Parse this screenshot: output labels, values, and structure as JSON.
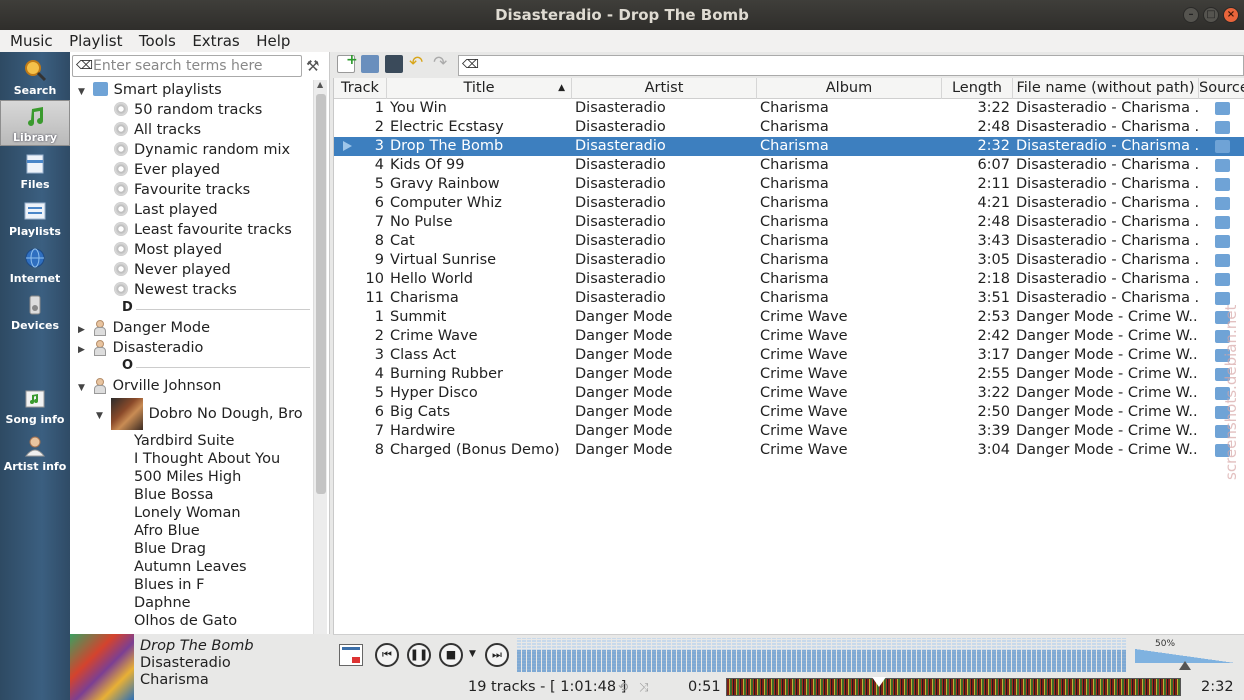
{
  "window": {
    "title": "Disasteradio - Drop The Bomb"
  },
  "menu": [
    "Music",
    "Playlist",
    "Tools",
    "Extras",
    "Help"
  ],
  "tabs": [
    {
      "label": "Search",
      "icon": "magnifier-icon"
    },
    {
      "label": "Library",
      "icon": "music-note-icon"
    },
    {
      "label": "Files",
      "icon": "files-icon"
    },
    {
      "label": "Playlists",
      "icon": "playlists-icon"
    },
    {
      "label": "Internet",
      "icon": "globe-icon"
    },
    {
      "label": "Devices",
      "icon": "devices-icon"
    },
    {
      "label": "Song info",
      "icon": "song-info-icon"
    },
    {
      "label": "Artist info",
      "icon": "artist-info-icon"
    }
  ],
  "library": {
    "search_placeholder": "Enter search terms here",
    "smart_playlists_label": "Smart playlists",
    "smart_playlists": [
      "50 random tracks",
      "All tracks",
      "Dynamic random mix",
      "Ever played",
      "Favourite tracks",
      "Last played",
      "Least favourite tracks",
      "Most played",
      "Never played",
      "Newest tracks"
    ],
    "divider_d": "D",
    "artists_d": [
      "Danger Mode",
      "Disasteradio"
    ],
    "divider_o": "O",
    "artist_o": "Orville Johnson",
    "album": "Dobro No Dough, Bro",
    "album_tracks": [
      "Yardbird Suite",
      "I Thought About You",
      "500 Miles High",
      "Blue Bossa",
      "Lonely Woman",
      "Afro Blue",
      "Blue Drag",
      "Autumn Leaves",
      "Blues in F",
      "Daphne",
      "Olhos de Gato"
    ]
  },
  "now_playing": {
    "title": "Drop The Bomb",
    "artist": "Disasteradio",
    "album": "Charisma"
  },
  "playlist": {
    "columns": [
      "Track",
      "Title",
      "Artist",
      "Album",
      "Length",
      "File name (without path)",
      "Source"
    ],
    "current_index": 2,
    "rows": [
      {
        "track": "1",
        "title": "You Win",
        "artist": "Disasteradio",
        "album": "Charisma",
        "length": "3:22",
        "file": "Disasteradio - Charisma ..."
      },
      {
        "track": "2",
        "title": "Electric Ecstasy",
        "artist": "Disasteradio",
        "album": "Charisma",
        "length": "2:48",
        "file": "Disasteradio - Charisma ..."
      },
      {
        "track": "3",
        "title": "Drop The Bomb",
        "artist": "Disasteradio",
        "album": "Charisma",
        "length": "2:32",
        "file": "Disasteradio - Charisma ..."
      },
      {
        "track": "4",
        "title": "Kids Of 99",
        "artist": "Disasteradio",
        "album": "Charisma",
        "length": "6:07",
        "file": "Disasteradio - Charisma ..."
      },
      {
        "track": "5",
        "title": "Gravy Rainbow",
        "artist": "Disasteradio",
        "album": "Charisma",
        "length": "2:11",
        "file": "Disasteradio - Charisma ..."
      },
      {
        "track": "6",
        "title": "Computer Whiz",
        "artist": "Disasteradio",
        "album": "Charisma",
        "length": "4:21",
        "file": "Disasteradio - Charisma ..."
      },
      {
        "track": "7",
        "title": "No Pulse",
        "artist": "Disasteradio",
        "album": "Charisma",
        "length": "2:48",
        "file": "Disasteradio - Charisma ..."
      },
      {
        "track": "8",
        "title": "Cat",
        "artist": "Disasteradio",
        "album": "Charisma",
        "length": "3:43",
        "file": "Disasteradio - Charisma ..."
      },
      {
        "track": "9",
        "title": "Virtual Sunrise",
        "artist": "Disasteradio",
        "album": "Charisma",
        "length": "3:05",
        "file": "Disasteradio - Charisma ..."
      },
      {
        "track": "10",
        "title": "Hello World",
        "artist": "Disasteradio",
        "album": "Charisma",
        "length": "2:18",
        "file": "Disasteradio - Charisma ..."
      },
      {
        "track": "11",
        "title": "Charisma",
        "artist": "Disasteradio",
        "album": "Charisma",
        "length": "3:51",
        "file": "Disasteradio - Charisma ..."
      },
      {
        "track": "1",
        "title": "Summit",
        "artist": "Danger Mode",
        "album": "Crime Wave",
        "length": "2:53",
        "file": "Danger Mode - Crime W..."
      },
      {
        "track": "2",
        "title": "Crime Wave",
        "artist": "Danger Mode",
        "album": "Crime Wave",
        "length": "2:42",
        "file": "Danger Mode - Crime W..."
      },
      {
        "track": "3",
        "title": "Class Act",
        "artist": "Danger Mode",
        "album": "Crime Wave",
        "length": "3:17",
        "file": "Danger Mode - Crime W..."
      },
      {
        "track": "4",
        "title": "Burning Rubber",
        "artist": "Danger Mode",
        "album": "Crime Wave",
        "length": "2:55",
        "file": "Danger Mode - Crime W..."
      },
      {
        "track": "5",
        "title": "Hyper Disco",
        "artist": "Danger Mode",
        "album": "Crime Wave",
        "length": "3:22",
        "file": "Danger Mode - Crime W..."
      },
      {
        "track": "6",
        "title": "Big Cats",
        "artist": "Danger Mode",
        "album": "Crime Wave",
        "length": "2:50",
        "file": "Danger Mode - Crime W..."
      },
      {
        "track": "7",
        "title": "Hardwire",
        "artist": "Danger Mode",
        "album": "Crime Wave",
        "length": "3:39",
        "file": "Danger Mode - Crime W..."
      },
      {
        "track": "8",
        "title": "Charged (Bonus Demo)",
        "artist": "Danger Mode",
        "album": "Crime Wave",
        "length": "3:04",
        "file": "Danger Mode - Crime W..."
      }
    ]
  },
  "player": {
    "volume_label": "50%",
    "volume": 0.5,
    "progress": 0.335
  },
  "status": {
    "track_count": "19 tracks - [ 1:01:48 ]",
    "elapsed": "0:51",
    "total": "2:32"
  },
  "watermark": "screenshots.debian.net",
  "colors": {
    "selection": "#3d7fbf",
    "tabbar": "#3b5f80"
  }
}
